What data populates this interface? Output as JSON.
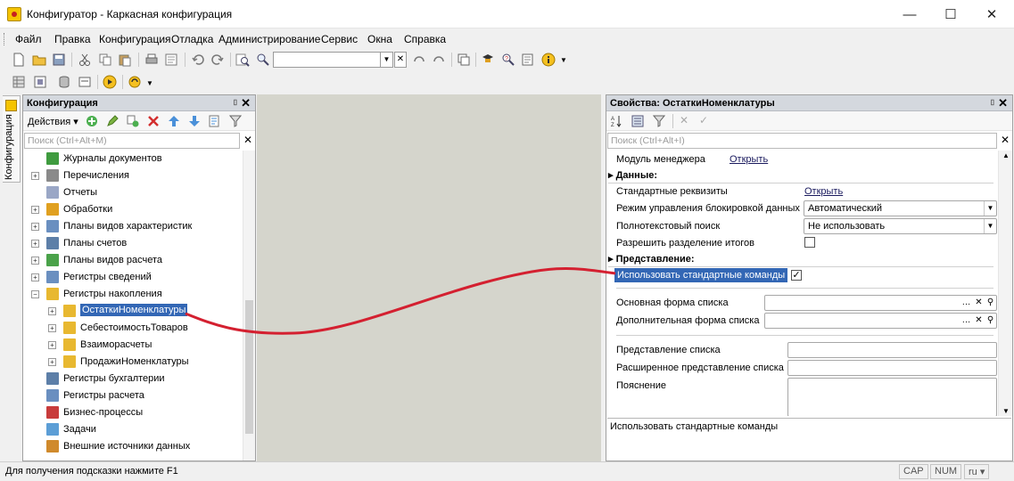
{
  "window": {
    "title": "Конфигуратор - Каркасная конфигурация",
    "minimize": "—",
    "maximize": "☐",
    "close": "✕"
  },
  "menu": [
    "Файл",
    "Правка",
    "Конфигурация",
    "Отладка",
    "Администрирование",
    "Сервис",
    "Окна",
    "Справка"
  ],
  "side_tab": {
    "label": "Конфигурация"
  },
  "config_panel": {
    "title": "Конфигурация",
    "actions_label": "Действия ▾",
    "search_placeholder": "Поиск (Ctrl+Alt+M)",
    "tree": [
      {
        "label": "Журналы документов",
        "icon": "doc-journal-icon",
        "color": "#3f9b3f"
      },
      {
        "label": "Перечисления",
        "icon": "enum-icon",
        "color": "#8a8a8a",
        "expander": "+"
      },
      {
        "label": "Отчеты",
        "icon": "report-icon",
        "color": "#9aa7c6"
      },
      {
        "label": "Обработки",
        "icon": "processing-icon",
        "color": "#e0a020",
        "expander": "+"
      },
      {
        "label": "Планы видов характеристик",
        "icon": "chart-types-icon",
        "color": "#6a8fc0",
        "expander": "+"
      },
      {
        "label": "Планы счетов",
        "icon": "chart-accounts-icon",
        "color": "#5d7fa8",
        "expander": "+"
      },
      {
        "label": "Планы видов расчета",
        "icon": "calc-types-icon",
        "color": "#4aa24a",
        "expander": "+"
      },
      {
        "label": "Регистры сведений",
        "icon": "info-register-icon",
        "color": "#6a8fc0",
        "expander": "+"
      },
      {
        "label": "Регистры накопления",
        "icon": "accumulation-register-icon",
        "color": "#e8b830",
        "expander": "−"
      },
      {
        "label": "ОстаткиНоменклатуры",
        "icon": "register-icon",
        "color": "#e8b830",
        "child": true,
        "selected": true,
        "expander": "+"
      },
      {
        "label": "СебестоимостьТоваров",
        "icon": "register-icon",
        "color": "#e8b830",
        "child": true,
        "expander": "+"
      },
      {
        "label": "Взаиморасчеты",
        "icon": "register-icon",
        "color": "#e8b830",
        "child": true,
        "expander": "+"
      },
      {
        "label": "ПродажиНоменклатуры",
        "icon": "register-icon",
        "color": "#e8b830",
        "child": true,
        "expander": "+"
      },
      {
        "label": "Регистры бухгалтерии",
        "icon": "accounting-register-icon",
        "color": "#5d7fa8"
      },
      {
        "label": "Регистры расчета",
        "icon": "calc-register-icon",
        "color": "#6a8fc0"
      },
      {
        "label": "Бизнес-процессы",
        "icon": "business-process-icon",
        "color": "#c83c3c"
      },
      {
        "label": "Задачи",
        "icon": "tasks-icon",
        "color": "#5c9ed6"
      },
      {
        "label": "Внешние источники данных",
        "icon": "external-source-icon",
        "color": "#d08a2c"
      }
    ]
  },
  "props_panel": {
    "title": "Свойства: ОстаткиНоменклатуры",
    "search_placeholder": "Поиск (Ctrl+Alt+I)",
    "manager_module_label": "Модуль менеджера",
    "manager_module_link": "Открыть",
    "section_data": "Данные:",
    "standard_attrs_label": "Стандартные реквизиты",
    "standard_attrs_link": "Открыть",
    "lock_mode_label": "Режим управления блокировкой данных",
    "lock_mode_value": "Автоматический",
    "fulltext_label": "Полнотекстовый поиск",
    "fulltext_value": "Не использовать",
    "split_totals_label": "Разрешить разделение итогов",
    "section_view": "Представление:",
    "std_commands_label": "Использовать стандартные команды",
    "std_commands_checked": "✓",
    "main_form_label": "Основная форма списка",
    "extra_form_label": "Дополнительная форма списка",
    "list_repr_label": "Представление списка",
    "ext_list_repr_label": "Расширенное представление списка",
    "explanation_label": "Пояснение",
    "description": "Использовать стандартные команды"
  },
  "status": {
    "hint": "Для получения подсказки нажмите F1",
    "cap": "CAP",
    "num": "NUM",
    "lang": "ru ▾"
  },
  "colors": {
    "selection": "#3367b5",
    "annotation_line": "#d42030",
    "panel_header": "#d4d8de"
  }
}
